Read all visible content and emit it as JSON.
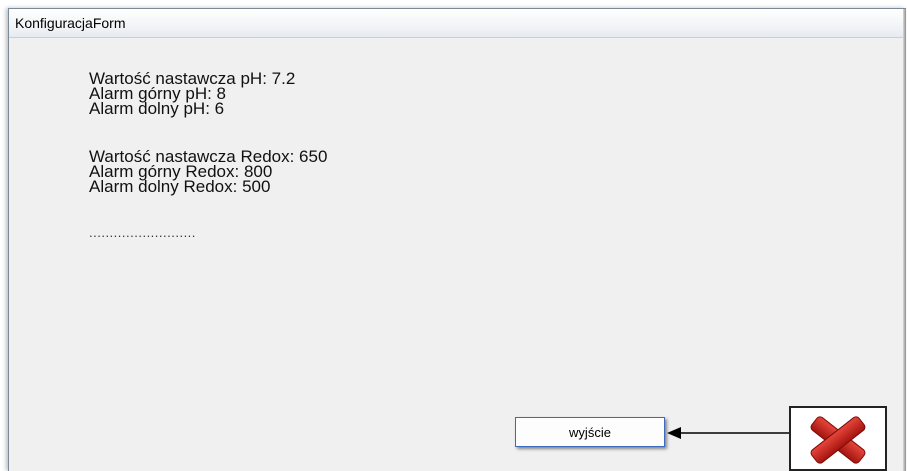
{
  "window": {
    "title": "KonfiguracjaForm"
  },
  "ph": {
    "setpoint": "Wartość nastawcza pH: 7.2",
    "alarm_high": "Alarm górny pH: 8",
    "alarm_low": "Alarm dolny pH: 6"
  },
  "redox": {
    "setpoint": "Wartość nastawcza Redox: 650",
    "alarm_high": "Alarm górny Redox: 800",
    "alarm_low": "Alarm dolny Redox: 500"
  },
  "ellipsis": "..........................",
  "buttons": {
    "exit_label": "wyjście"
  },
  "icons": {
    "close": "red-x-close-icon",
    "arrow": "arrow-left-icon"
  },
  "colors": {
    "close_red": "#c8201a",
    "button_border": "#3a6bbf"
  }
}
